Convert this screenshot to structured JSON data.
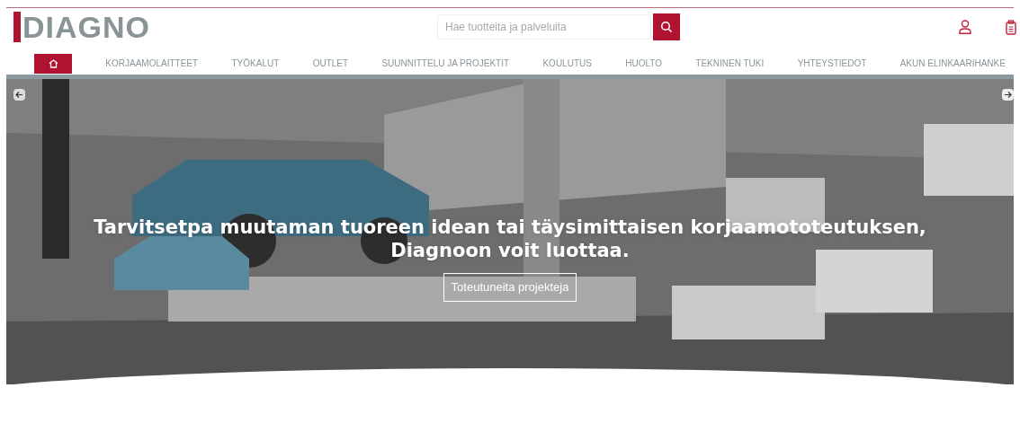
{
  "logo": {
    "text": "DIAGNO"
  },
  "search": {
    "placeholder": "Hae tuotteita ja palveluita"
  },
  "nav": {
    "items": [
      {
        "kind": "home",
        "selected": true
      },
      {
        "label": "KORJAAMOLAITTEET",
        "selected": false
      },
      {
        "label": "TYÖKALUT",
        "selected": false
      },
      {
        "label": "OUTLET",
        "selected": false
      },
      {
        "label": "SUUNNITTELU JA PROJEKTIT",
        "selected": false
      },
      {
        "label": "KOULUTUS",
        "selected": false
      },
      {
        "label": "HUOLTO",
        "selected": false
      },
      {
        "label": "TEKNINEN TUKI",
        "selected": false
      },
      {
        "label": "YHTEYSTIEDOT",
        "selected": false
      },
      {
        "label": "AKUN ELINKAARIHANKE",
        "selected": false
      }
    ]
  },
  "hero": {
    "heading_lines": [
      "Tarvitsetpa muutaman tuoreen idean tai täysimittaisen korjaamototeutuksen,",
      "Diagnoon voit luottaa."
    ],
    "button": "Toteutuneita projekteja"
  }
}
